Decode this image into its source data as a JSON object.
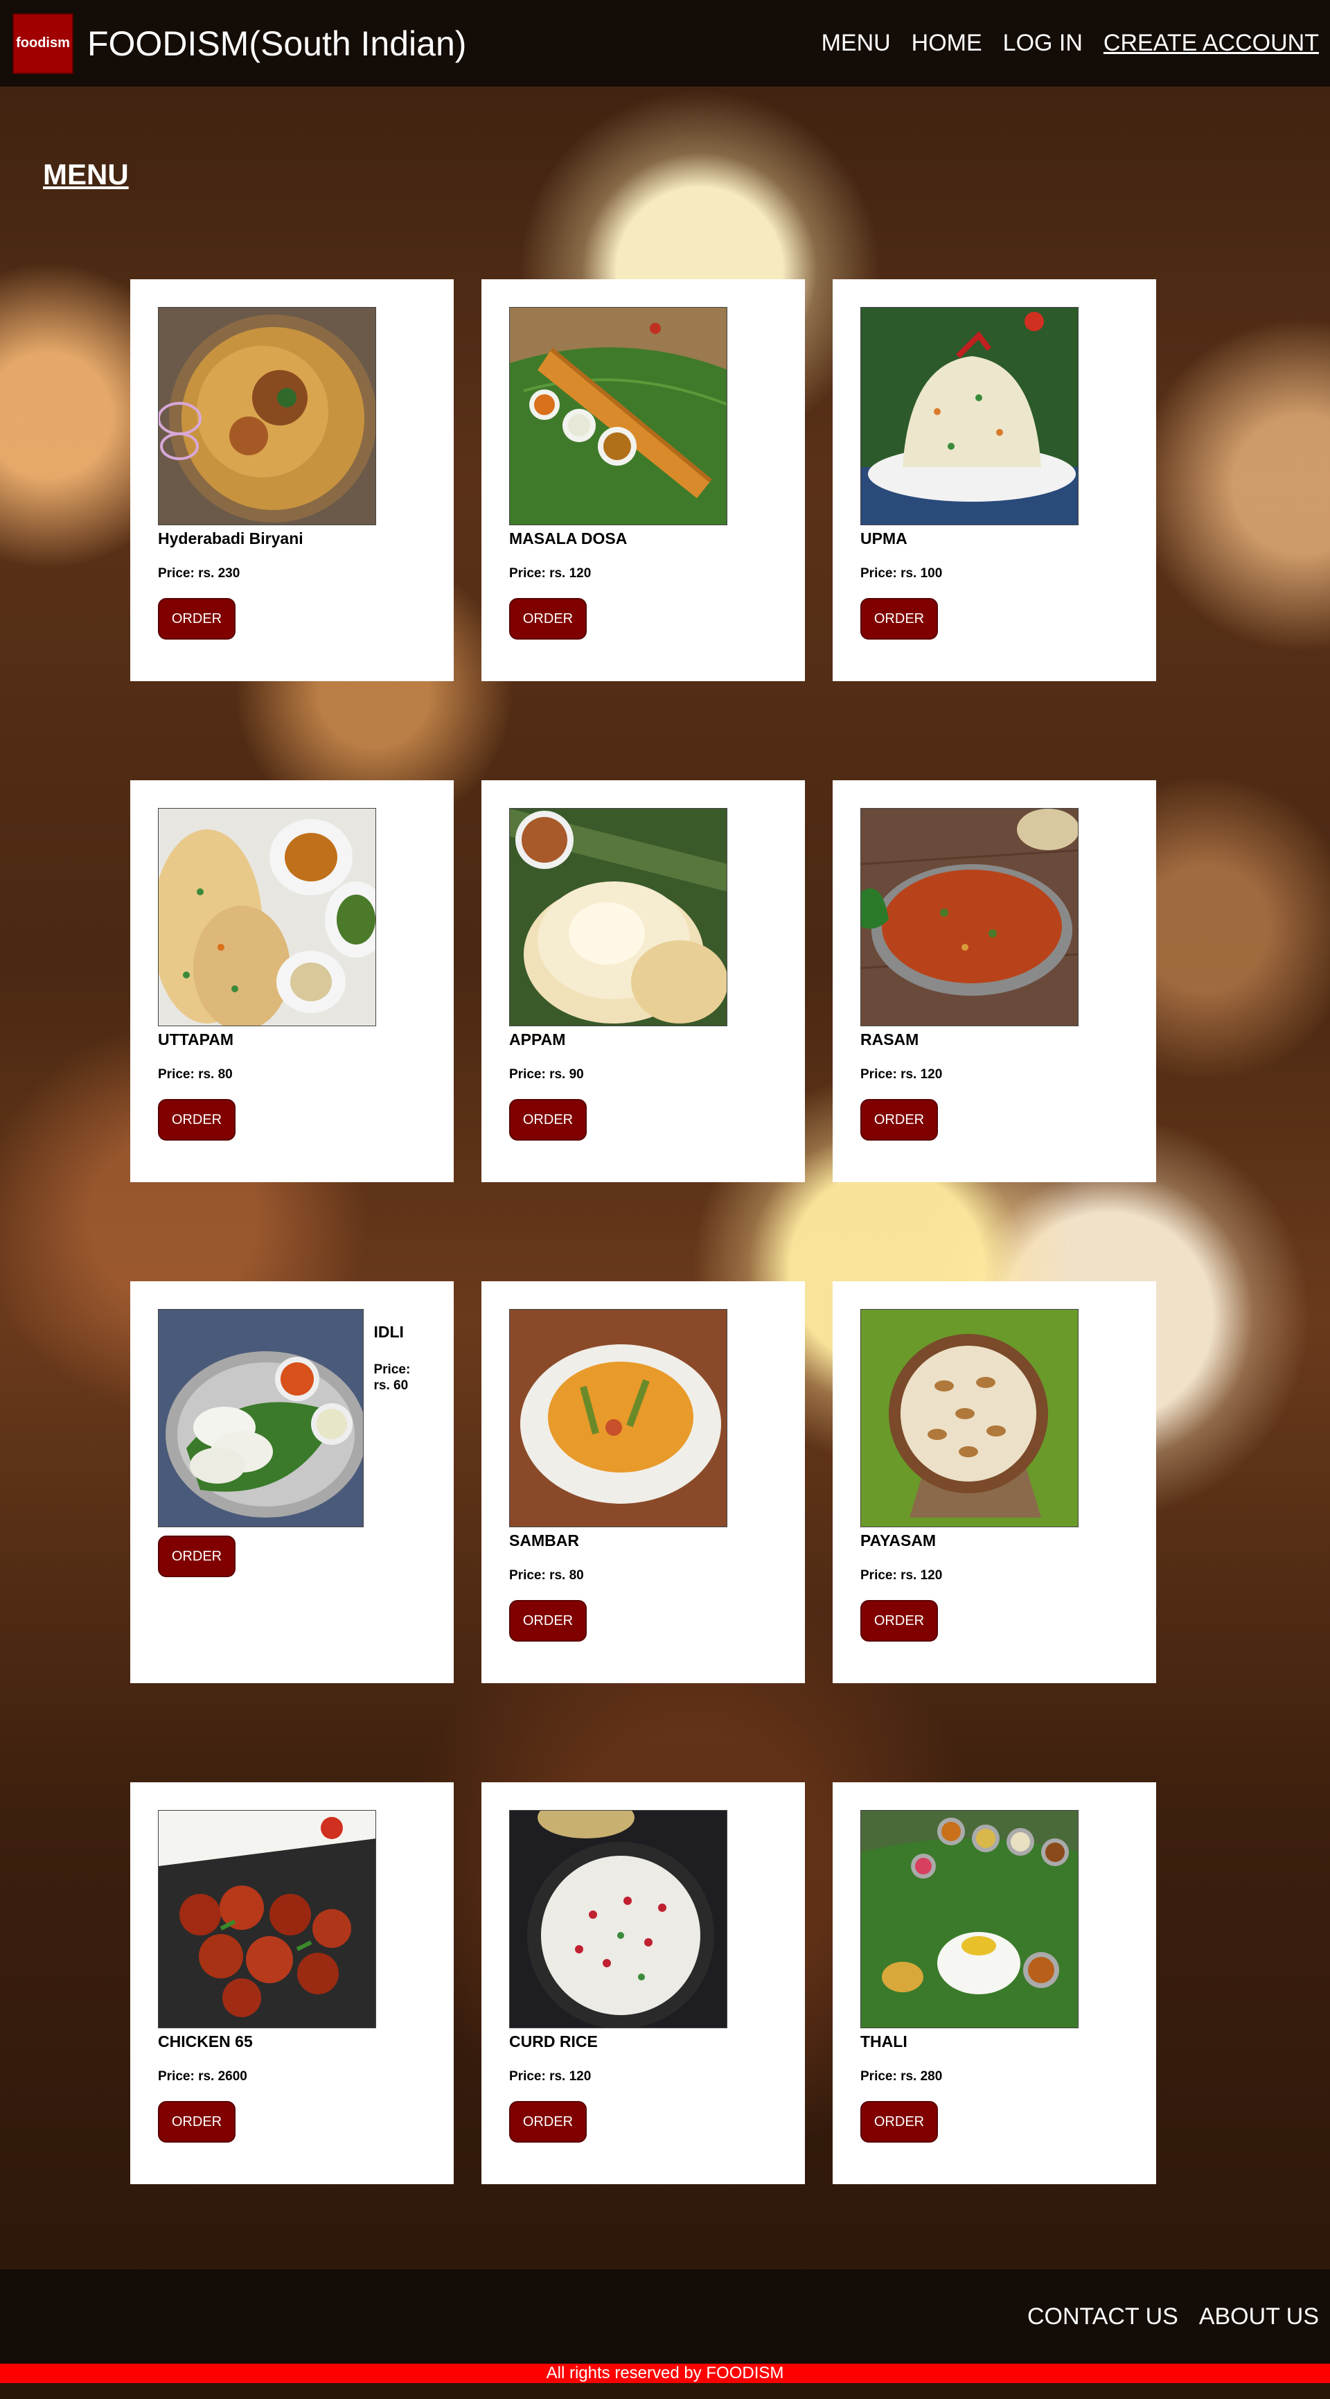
{
  "header": {
    "logo_text": "foodism",
    "site_title": "FOODISM(South Indian)",
    "nav": [
      "MENU",
      "HOME",
      "LOG IN",
      "CREATE ACCOUNT"
    ]
  },
  "page": {
    "heading": "MENU"
  },
  "menu": [
    {
      "name": "Hyderabadi Biryani",
      "price": "Price: rs. 230",
      "order": "ORDER"
    },
    {
      "name": "MASALA DOSA",
      "price": "Price: rs. 120",
      "order": "ORDER"
    },
    {
      "name": "UPMA",
      "price": "Price: rs. 100",
      "order": "ORDER"
    },
    {
      "name": "UTTAPAM",
      "price": "Price: rs. 80",
      "order": "ORDER"
    },
    {
      "name": "APPAM",
      "price": "Price: rs. 90",
      "order": "ORDER"
    },
    {
      "name": "RASAM",
      "price": "Price: rs. 120",
      "order": "ORDER"
    },
    {
      "name": "IDLI",
      "price": "Price: rs. 60",
      "order": "ORDER"
    },
    {
      "name": "SAMBAR",
      "price": "Price: rs. 80",
      "order": "ORDER"
    },
    {
      "name": "PAYASAM",
      "price": "Price: rs. 120",
      "order": "ORDER"
    },
    {
      "name": "CHICKEN 65",
      "price": "Price: rs. 2600",
      "order": "ORDER"
    },
    {
      "name": "CURD RICE",
      "price": "Price: rs. 120",
      "order": "ORDER"
    },
    {
      "name": "THALI",
      "price": "Price: rs. 280",
      "order": "ORDER"
    }
  ],
  "footer": {
    "links": [
      "CONTACT US",
      "ABOUT US"
    ],
    "copyright": "All rights reserved by FOODISM"
  },
  "colors": {
    "header_bg": "#140c07",
    "accent": "#800000",
    "copyright_bar": "#ff0000"
  }
}
